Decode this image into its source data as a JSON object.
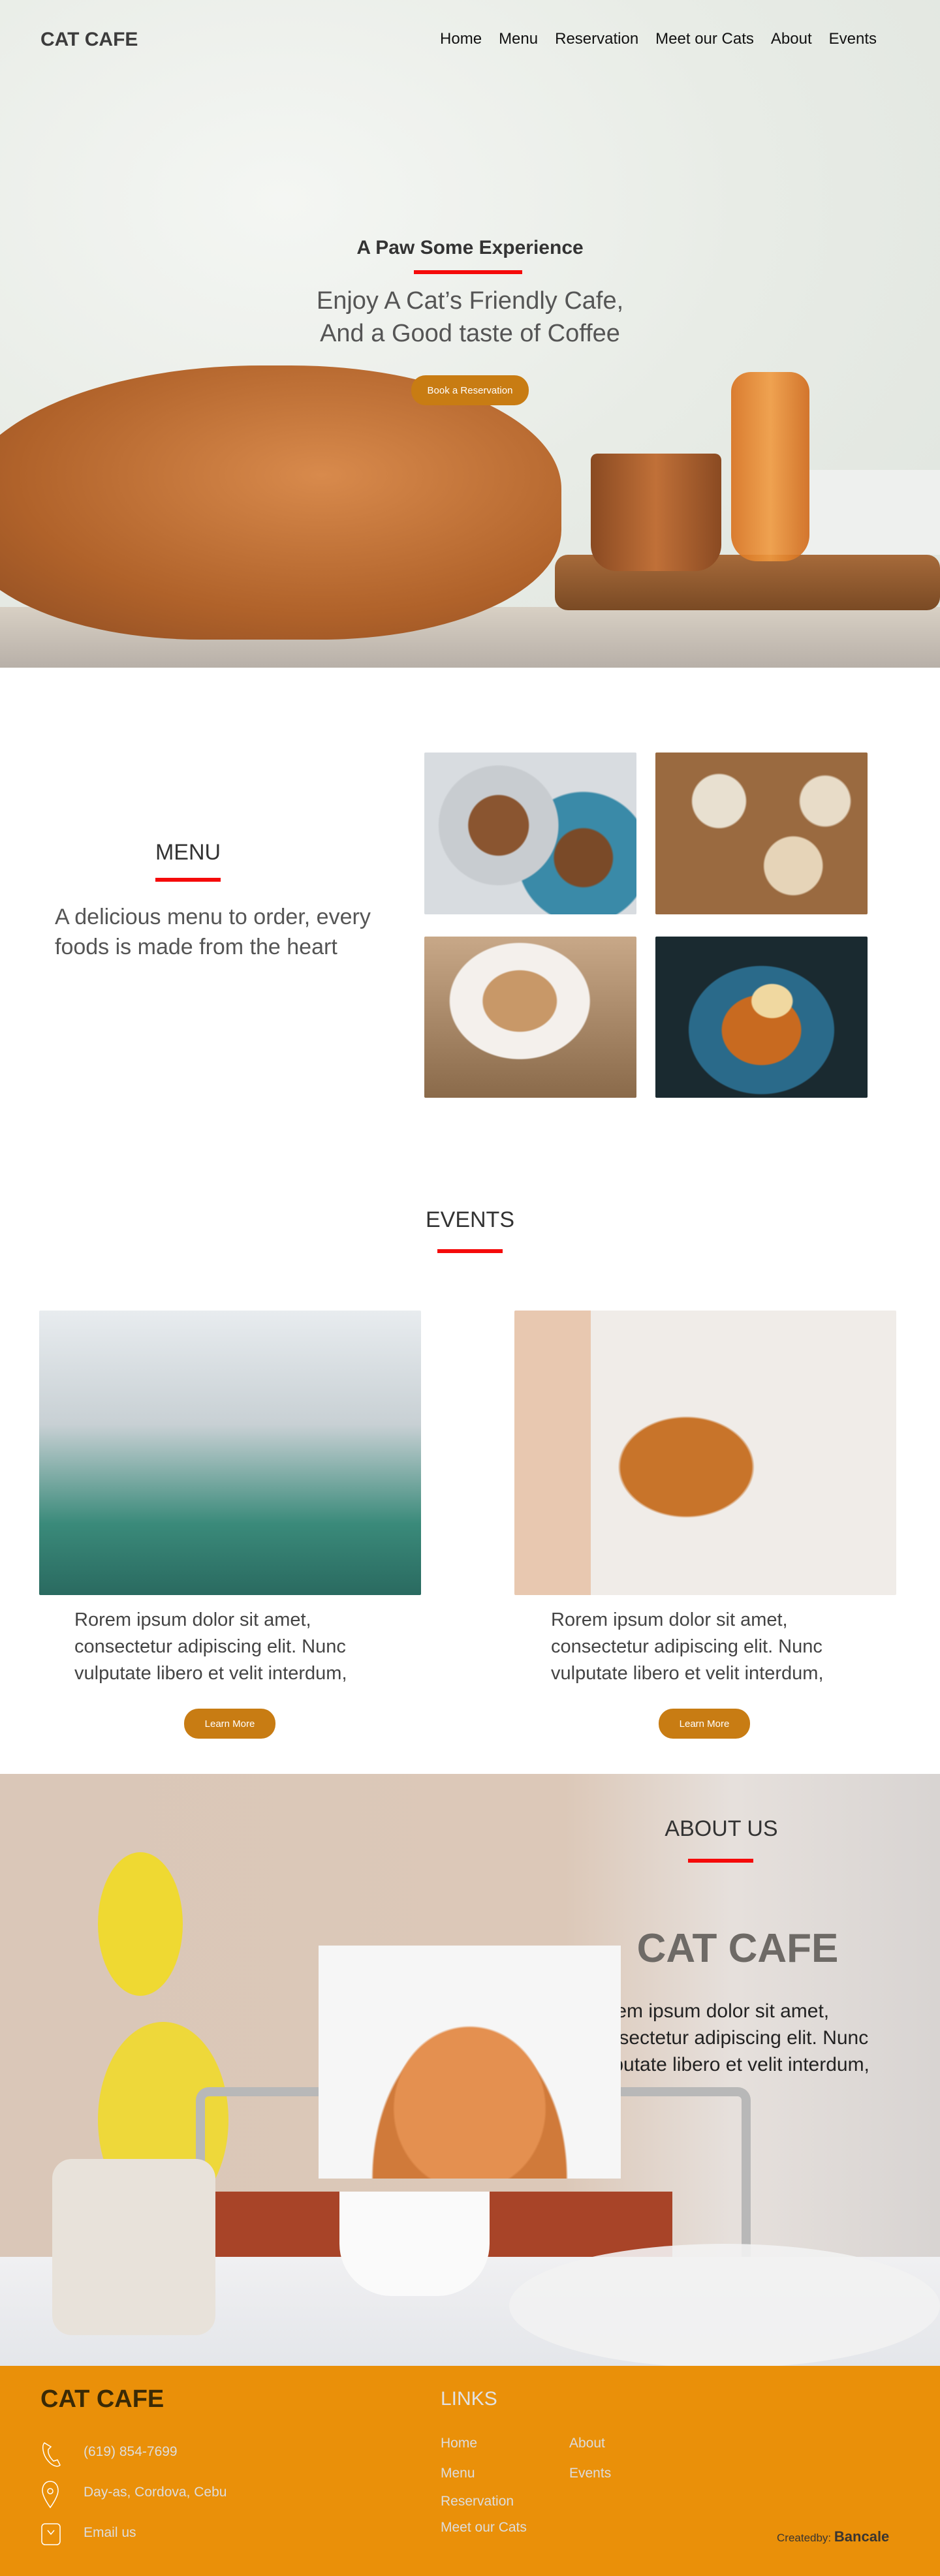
{
  "header": {
    "logo": "CAT CAFE",
    "nav": [
      "Home",
      "Menu",
      "Reservation",
      "Meet our Cats",
      "About",
      "Events"
    ]
  },
  "hero": {
    "title": "A Paw Some Experience",
    "subtitle_line1": "Enjoy A Cat’s Friendly Cafe,",
    "subtitle_line2": "And a Good taste of Coffee",
    "button": "Book a Reservation"
  },
  "menu": {
    "heading": "MENU",
    "text": "A delicious menu  to order, every foods is made from the heart"
  },
  "events": {
    "heading": "EVENTS",
    "items": [
      {
        "text": "Rorem ipsum dolor sit amet, consectetur adipiscing elit. Nunc vulputate libero et velit interdum,",
        "button": "Learn More"
      },
      {
        "text": "Rorem ipsum dolor sit amet, consectetur adipiscing elit. Nunc vulputate libero et velit interdum,",
        "button": "Learn More"
      }
    ]
  },
  "about": {
    "heading": "ABOUT US",
    "title": "CAT CAFE",
    "text_line1": "Lorem ipsum dolor sit amet,",
    "text_line2": "consectetur adipiscing elit. Nunc",
    "text_line3": "vulputate libero et velit interdum,"
  },
  "footer": {
    "logo": "CAT CAFE",
    "phone": "(619) 854-7699",
    "address": "Day-as, Cordova, Cebu",
    "email": "Email us",
    "links_heading": "LINKS",
    "links": [
      "Home",
      "About",
      "Menu",
      "Events",
      "Reservation",
      "Meet our Cats"
    ],
    "created_label": "Createdby:",
    "created_name": "Bancale"
  },
  "colors": {
    "accent": "#c87c13",
    "footer_bg": "#ea9009",
    "underline": "#f50a0a"
  }
}
